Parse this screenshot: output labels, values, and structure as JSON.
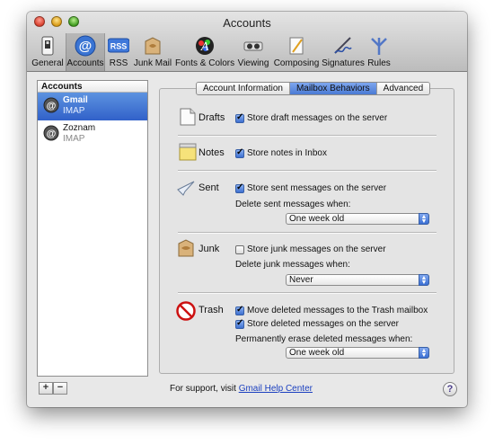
{
  "window": {
    "title": "Accounts"
  },
  "toolbar": {
    "items": [
      {
        "label": "General",
        "icon": "general-switch-icon"
      },
      {
        "label": "Accounts",
        "icon": "at-sign-icon",
        "selected": true
      },
      {
        "label": "RSS",
        "icon": "rss-icon"
      },
      {
        "label": "Junk Mail",
        "icon": "junk-mail-icon"
      },
      {
        "label": "Fonts & Colors",
        "icon": "fonts-colors-icon"
      },
      {
        "label": "Viewing",
        "icon": "viewing-icon"
      },
      {
        "label": "Composing",
        "icon": "composing-icon"
      },
      {
        "label": "Signatures",
        "icon": "signatures-icon"
      },
      {
        "label": "Rules",
        "icon": "rules-icon"
      }
    ]
  },
  "accounts": {
    "header": "Accounts",
    "items": [
      {
        "name": "Gmail",
        "type": "IMAP",
        "selected": true
      },
      {
        "name": "Zoznam",
        "type": "IMAP",
        "selected": false
      }
    ],
    "add_label": "+",
    "remove_label": "−"
  },
  "tabs": [
    {
      "label": "Account Information",
      "active": false
    },
    {
      "label": "Mailbox Behaviors",
      "active": true
    },
    {
      "label": "Advanced",
      "active": false
    }
  ],
  "sections": {
    "drafts": {
      "title": "Drafts",
      "option": "Store draft messages on the server",
      "checked": true
    },
    "notes": {
      "title": "Notes",
      "option": "Store notes in Inbox",
      "checked": true
    },
    "sent": {
      "title": "Sent",
      "option": "Store sent messages on the server",
      "checked": true,
      "delete_label": "Delete sent messages when:",
      "delete_value": "One week old"
    },
    "junk": {
      "title": "Junk",
      "option": "Store junk messages on the server",
      "checked": false,
      "delete_label": "Delete junk messages when:",
      "delete_value": "Never"
    },
    "trash": {
      "title": "Trash",
      "option_move": "Move deleted messages to the Trash mailbox",
      "move_checked": true,
      "option_store": "Store deleted messages on the server",
      "store_checked": true,
      "erase_label": "Permanently erase deleted messages when:",
      "erase_value": "One week old"
    }
  },
  "footer": {
    "support_text": "For support, visit ",
    "support_link": "Gmail Help Center",
    "help_label": "?"
  },
  "colors": {
    "selection": "#3d6fd0",
    "link": "#1a3fbf"
  }
}
